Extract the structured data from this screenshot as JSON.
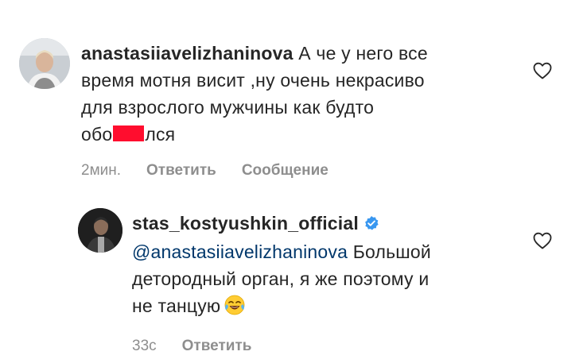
{
  "comments": [
    {
      "username": "anastasiiavelizhaninova",
      "text_line1": "А че у него все",
      "text_line2": "время мотня  висит ,ну очень некрасиво",
      "text_line3": "для взрослого мужчины как будто",
      "text_line4_before": "обо",
      "text_line4_after": "лся",
      "time": "2мин.",
      "reply_label": "Ответить",
      "message_label": "Сообщение",
      "icon": "heart-outline-icon"
    },
    {
      "username": "stas_kostyushkin_official",
      "verified": true,
      "mention": "@anastasiiavelizhaninova",
      "text_part1": "Большой",
      "text_line2": "детородный орган, я же поэтому и",
      "text_line3": "не танцую",
      "emoji": "face-with-tears-of-joy",
      "time": "33с",
      "reply_label": "Ответить",
      "icon": "heart-outline-icon"
    }
  ],
  "colors": {
    "text": "#262626",
    "secondary": "#8e8e8e",
    "mention": "#00376b",
    "verified": "#3897f0",
    "redaction": "#ff0d2e"
  }
}
